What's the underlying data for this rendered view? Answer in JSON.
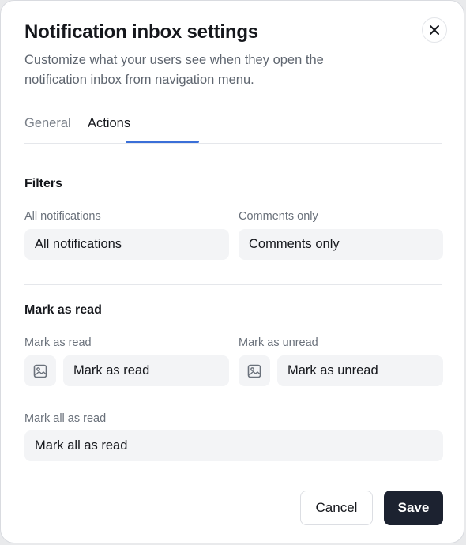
{
  "dialog": {
    "title": "Notification inbox settings",
    "subtitle": "Customize what your users see when they open the notification inbox from navigation menu."
  },
  "tabs": [
    {
      "label": "General",
      "active": false
    },
    {
      "label": "Actions",
      "active": true
    }
  ],
  "filters": {
    "title": "Filters",
    "fields": [
      {
        "label": "All notifications",
        "value": "All notifications"
      },
      {
        "label": "Comments only",
        "value": "Comments only"
      }
    ]
  },
  "mark_as_read": {
    "title": "Mark as read",
    "fields": [
      {
        "label": "Mark as read",
        "value": "Mark as read",
        "icon": "image-icon"
      },
      {
        "label": "Mark as unread",
        "value": "Mark as unread",
        "icon": "image-icon"
      },
      {
        "label": "Mark all as read",
        "value": "Mark all as read"
      }
    ]
  },
  "footer": {
    "cancel_label": "Cancel",
    "save_label": "Save"
  },
  "colors": {
    "accent": "#3a6fd8",
    "primary_button": "#1c2230",
    "input_bg": "#f3f4f6"
  }
}
